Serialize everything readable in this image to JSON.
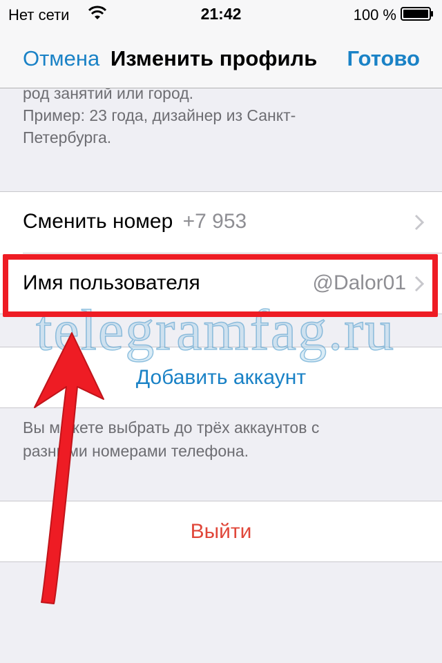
{
  "status_bar": {
    "carrier": "Нет сети",
    "time": "21:42",
    "battery": "100 %",
    "wifi_icon": "wifi-icon",
    "battery_icon": "battery-icon"
  },
  "nav": {
    "cancel": "Отмена",
    "title": "Изменить профиль",
    "done": "Готово"
  },
  "hint_top": {
    "line1": "род занятий или город.",
    "line2": "Пример: 23 года, дизайнер из Санкт-",
    "line3": "Петербурга."
  },
  "settings": {
    "change_number": {
      "label": "Сменить номер",
      "value": "+7 953"
    },
    "username": {
      "label": "Имя пользователя",
      "value": "@Dalor01"
    }
  },
  "add_account": {
    "label": "Добавить аккаунт"
  },
  "hint_bottom": {
    "line1": "Вы можете выбрать до трёх аккаунтов с",
    "line2": "разными номерами телефона."
  },
  "logout": {
    "label": "Выйти"
  },
  "watermark": "telegramfag.ru",
  "colors": {
    "accent": "#1a82c6",
    "destructive": "#e0473a",
    "highlight": "#ee1c24",
    "background": "#efeff4"
  }
}
